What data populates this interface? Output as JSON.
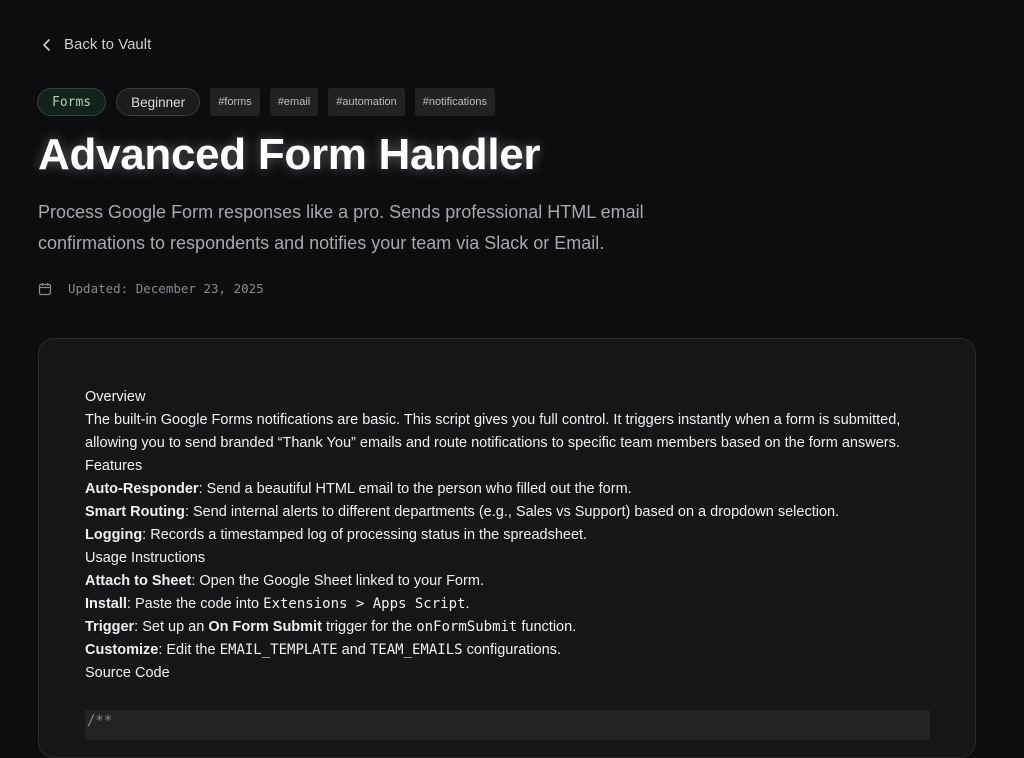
{
  "nav": {
    "back_label": "Back to Vault"
  },
  "tags": {
    "category": "Forms",
    "level": "Beginner",
    "hashtags": [
      "#forms",
      "#email",
      "#automation",
      "#notifications"
    ]
  },
  "header": {
    "title": "Advanced Form Handler",
    "description": "Process Google Form responses like a pro. Sends professional HTML email confirmations to respondents and notifies your team via Slack or Email.",
    "updated": "Updated: December 23, 2025"
  },
  "content": {
    "overview_heading": "Overview",
    "overview_text": "The built-in Google Forms notifications are basic. This script gives you full control. It triggers instantly when a form is submitted, allowing you to send branded “Thank You” emails and route notifications to specific team members based on the form answers.",
    "features_heading": "Features",
    "features": [
      {
        "label": "Auto-Responder",
        "text": ": Send a beautiful HTML email to the person who filled out the form."
      },
      {
        "label": "Smart Routing",
        "text": ": Send internal alerts to different departments (e.g., Sales vs Support) based on a dropdown selection."
      },
      {
        "label": "Logging",
        "text": ": Records a timestamped log of processing status in the spreadsheet."
      }
    ],
    "usage_heading": "Usage Instructions",
    "steps": {
      "attach": {
        "label": "Attach to Sheet",
        "text": ": Open the Google Sheet linked to your Form."
      },
      "install": {
        "label": "Install",
        "text": ": Paste the code into ",
        "code": "Extensions > Apps Script",
        "end": "."
      },
      "trigger": {
        "label": "Trigger",
        "text1": ": Set up an ",
        "bold": "On Form Submit",
        "text2": " trigger for the ",
        "code": "onFormSubmit",
        "end": " function."
      },
      "customize": {
        "label": "Customize",
        "text1": ": Edit the ",
        "code1": "EMAIL_TEMPLATE",
        "text2": " and ",
        "code2": "TEAM_EMAILS",
        "end": " configurations."
      }
    },
    "source_heading": "Source Code",
    "code_first_line": "/**"
  },
  "colors": {
    "background": "#0d0d0f",
    "card": "#161618",
    "category_pill": "#14221c",
    "accent_green": "#a9cdb9"
  }
}
